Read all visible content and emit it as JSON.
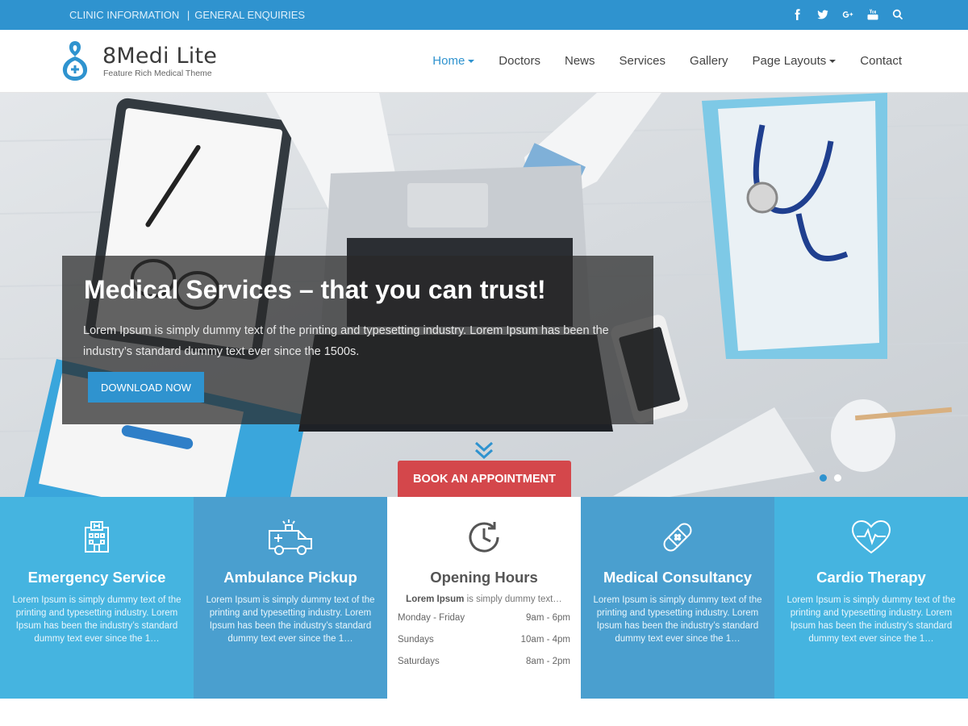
{
  "topbar": {
    "links": [
      "CLINIC INFORMATION",
      "GENERAL ENQUIRIES"
    ],
    "social_icons": [
      "facebook-icon",
      "twitter-icon",
      "google-plus-icon",
      "youtube-icon",
      "search-icon"
    ],
    "color": "#2f93cf"
  },
  "brand": {
    "title": "8Medi Lite",
    "tagline": "Feature Rich Medical Theme"
  },
  "nav": {
    "items": [
      {
        "label": "Home",
        "active": true,
        "dropdown": true
      },
      {
        "label": "Doctors"
      },
      {
        "label": "News"
      },
      {
        "label": "Services"
      },
      {
        "label": "Gallery"
      },
      {
        "label": "Page Layouts",
        "dropdown": true
      },
      {
        "label": "Contact"
      }
    ]
  },
  "hero": {
    "title": "Medical Services – that you can trust!",
    "text": "Lorem Ipsum is simply dummy text of the printing and typesetting industry. Lorem Ipsum has been the industry’s standard dummy text ever since the 1500s.",
    "button": "DOWNLOAD NOW",
    "appointment_button": "BOOK AN APPOINTMENT",
    "slides": 2,
    "active_slide": 1
  },
  "services": [
    {
      "title": "Emergency Service",
      "icon": "hospital-icon",
      "text": "Lorem Ipsum is simply dummy text of the printing and typesetting industry. Lorem Ipsum has been the industry’s standard dummy text ever since the 1…",
      "color": "#45b4e0"
    },
    {
      "title": "Ambulance Pickup",
      "icon": "ambulance-icon",
      "text": "Lorem Ipsum is simply dummy text of the printing and typesetting industry. Lorem Ipsum has been the industry’s standard dummy text ever since the 1…",
      "color": "#4a9fcf"
    },
    {
      "title": "Opening Hours",
      "icon": "clock-icon",
      "lead_bold": "Lorem Ipsum",
      "lead_rest": " is simply dummy text…",
      "hours": [
        {
          "day": "Monday - Friday",
          "time": "9am - 6pm"
        },
        {
          "day": "Sundays",
          "time": "10am - 4pm"
        },
        {
          "day": "Saturdays",
          "time": "8am - 2pm"
        }
      ]
    },
    {
      "title": "Medical Consultancy",
      "icon": "bandage-icon",
      "text": "Lorem Ipsum is simply dummy text of the printing and typesetting industry. Lorem Ipsum has been the industry’s standard dummy text ever since the 1…",
      "color": "#4a9fcf"
    },
    {
      "title": "Cardio Therapy",
      "icon": "heart-pulse-icon",
      "text": "Lorem Ipsum is simply dummy text of the printing and typesetting industry. Lorem Ipsum has been the industry’s standard dummy text ever since the 1…",
      "color": "#45b4e0"
    }
  ]
}
